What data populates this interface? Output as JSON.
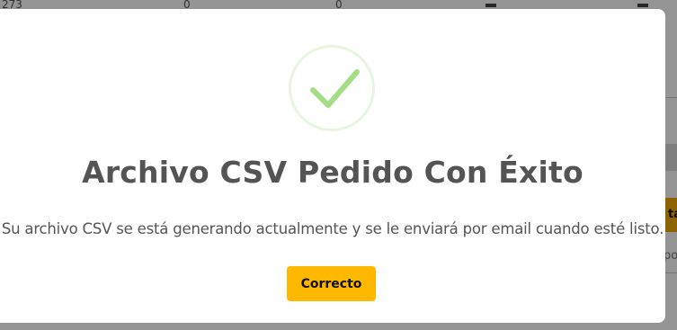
{
  "background": {
    "row_values": [
      "273",
      "0",
      "0"
    ],
    "side_button_text": "ta",
    "side_text": "po"
  },
  "modal": {
    "icon": "success-check-icon",
    "title": "Archivo CSV Pedido Con Éxito",
    "message": "Su archivo CSV se está generando actualmente y se le enviará por email cuando esté listo.",
    "confirm_label": "Correcto"
  },
  "colors": {
    "accent": "#ffb800",
    "success": "#a5dc86",
    "text": "#545454"
  }
}
